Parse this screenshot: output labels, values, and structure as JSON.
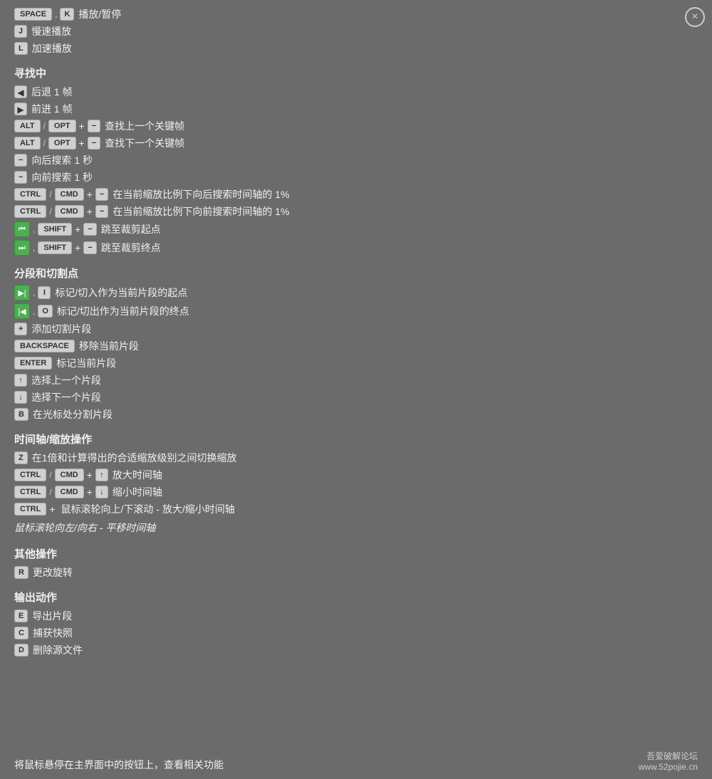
{
  "close_button": "×",
  "sections": [
    {
      "id": "playback",
      "shortcuts": [
        {
          "keys": [
            [
              "SPACE",
              "wide"
            ],
            [
              "K",
              "normal"
            ]
          ],
          "separators": [
            ","
          ],
          "desc": "播放/暂停"
        },
        {
          "keys": [
            [
              "J",
              "normal"
            ]
          ],
          "desc": "慢速播放"
        },
        {
          "keys": [
            [
              "L",
              "normal"
            ]
          ],
          "desc": "加速播放"
        }
      ]
    },
    {
      "id": "seeking",
      "title": "寻找中",
      "shortcuts": [
        {
          "type": "arrow_left",
          "desc": "后退 1 帧"
        },
        {
          "type": "arrow_right",
          "desc": "前进 1 帧"
        },
        {
          "type": "alt_opt_minus",
          "desc": "查找上一个关键帧"
        },
        {
          "type": "alt_opt_plus_minus",
          "desc": "查找下一个关键帧"
        },
        {
          "type": "minus_back",
          "desc": "向后搜索 1 秒"
        },
        {
          "type": "minus_forward",
          "desc": "向前搜索 1 秒"
        },
        {
          "type": "ctrl_cmd_minus_back",
          "desc": "在当前缩放比例下向后搜索时间轴的 1%"
        },
        {
          "type": "ctrl_cmd_minus_forward",
          "desc": "在当前缩放比例下向前搜索时间轴的 1%"
        },
        {
          "type": "green_left_shift_minus",
          "desc": "跳至裁剪起点"
        },
        {
          "type": "green_right_shift_minus",
          "desc": "跳至裁剪终点"
        }
      ]
    },
    {
      "id": "segments",
      "title": "分段和切割点",
      "shortcuts": [
        {
          "type": "green_mark_I",
          "desc": "标记/切入作为当前片段的起点"
        },
        {
          "type": "green_mark_O",
          "desc": "标记/切出作为当前片段的终点"
        },
        {
          "type": "plus_add",
          "desc": "添加切割片段"
        },
        {
          "type": "backspace",
          "desc": "移除当前片段"
        },
        {
          "type": "enter",
          "desc": "标记当前片段"
        },
        {
          "type": "up_arrow",
          "desc": "选择上一个片段"
        },
        {
          "type": "down_arrow",
          "desc": "选择下一个片段"
        },
        {
          "type": "b_key",
          "desc": "在光标处分割片段"
        }
      ]
    },
    {
      "id": "timeline",
      "title": "时间轴/缩放操作",
      "shortcuts": [
        {
          "type": "z_key",
          "desc": "在1倍和计算得出的合适缩放级别之间切换缩放"
        },
        {
          "type": "ctrl_cmd_up",
          "desc": "放大时间轴"
        },
        {
          "type": "ctrl_cmd_down",
          "desc": "缩小时间轴"
        },
        {
          "type": "ctrl_scroll",
          "desc": "鼠标滚轮向上/下滚动 - 放大/缩小时间轴"
        },
        {
          "type": "mouse_lr",
          "desc": "鼠标滚轮向左/向右 - 平移时间轴",
          "italic": true
        }
      ]
    },
    {
      "id": "other",
      "title": "其他操作",
      "shortcuts": [
        {
          "type": "r_key",
          "desc": "更改旋转"
        }
      ]
    },
    {
      "id": "output",
      "title": "输出动作",
      "shortcuts": [
        {
          "type": "e_key",
          "desc": "导出片段"
        },
        {
          "type": "c_key",
          "desc": "捕获快照"
        },
        {
          "type": "d_key",
          "desc": "删除源文件"
        }
      ]
    }
  ],
  "bottom_hint": "将鼠标悬停在主界面中的按钮上，查看相关功能",
  "watermark_line1": "吾爱破解论坛",
  "watermark_line2": "www.52pojie.cn"
}
